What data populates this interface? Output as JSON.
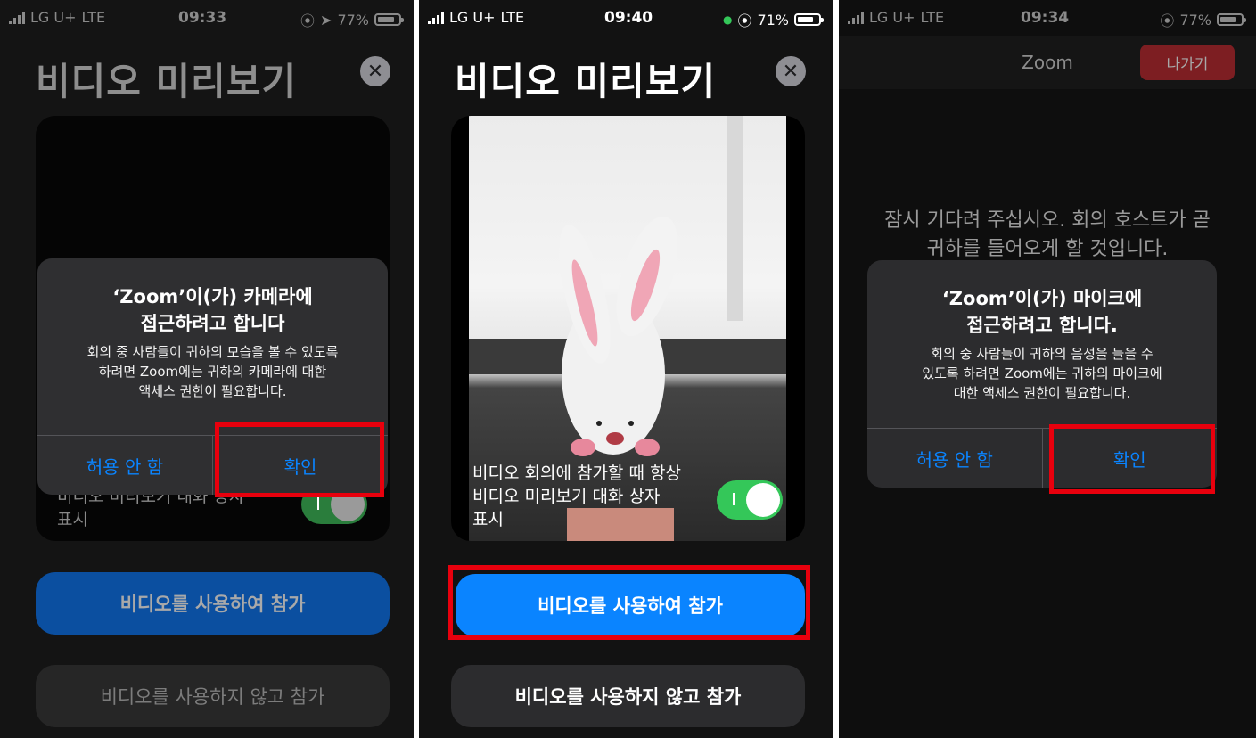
{
  "status_bars": [
    {
      "carrier": "LG U+",
      "network": "LTE",
      "time": "09:33",
      "battery": "77%"
    },
    {
      "carrier": "LG U+",
      "network": "LTE",
      "time": "09:40",
      "battery": "71%"
    },
    {
      "carrier": "LG U+",
      "network": "LTE",
      "time": "09:34",
      "battery": "77%"
    }
  ],
  "panel1": {
    "title": "비디오 미리보기",
    "toggle_label_line1": "비디오 미리보기 대화 상자",
    "toggle_label_line2": "표시",
    "join_with_video": "비디오를 사용하여 참가",
    "join_without_video": "비디오를 사용하지 않고 참가",
    "alert": {
      "title_line1": "‘Zoom’이(가) 카메라에",
      "title_line2": "접근하려고 합니다",
      "msg_line1": "회의 중 사람들이 귀하의 모습을 볼 수 있도록",
      "msg_line2": "하려면 Zoom에는 귀하의 카메라에 대한",
      "msg_line3": "액세스 권한이 필요합니다.",
      "deny": "허용 안 함",
      "ok": "확인"
    }
  },
  "panel2": {
    "title": "비디오 미리보기",
    "toggle_label_line1": "비디오 회의에 참가할 때 항상",
    "toggle_label_line2": "비디오 미리보기 대화 상자",
    "toggle_label_line3": "표시",
    "join_with_video": "비디오를 사용하여 참가",
    "join_without_video": "비디오를 사용하지 않고 참가"
  },
  "panel3": {
    "nav_title": "Zoom",
    "leave": "나가기",
    "waiting_line1": "잠시 기다려 주십시오. 회의 호스트가 곧",
    "waiting_line2": "귀하를 들어오게 할 것입니다.",
    "alert": {
      "title_line1": "‘Zoom’이(가) 마이크에",
      "title_line2": "접근하려고 합니다.",
      "msg_line1": "회의 중 사람들이 귀하의 음성을 들을 수",
      "msg_line2": "있도록 하려면 Zoom에는 귀하의 마이크에",
      "msg_line3": "대한 액세스 권한이 필요합니다.",
      "deny": "허용 안 함",
      "ok": "확인"
    }
  },
  "colors": {
    "accent": "#0a84ff",
    "highlight": "#e8000d",
    "toggle_on": "#34c759",
    "leave": "#c0272d"
  }
}
